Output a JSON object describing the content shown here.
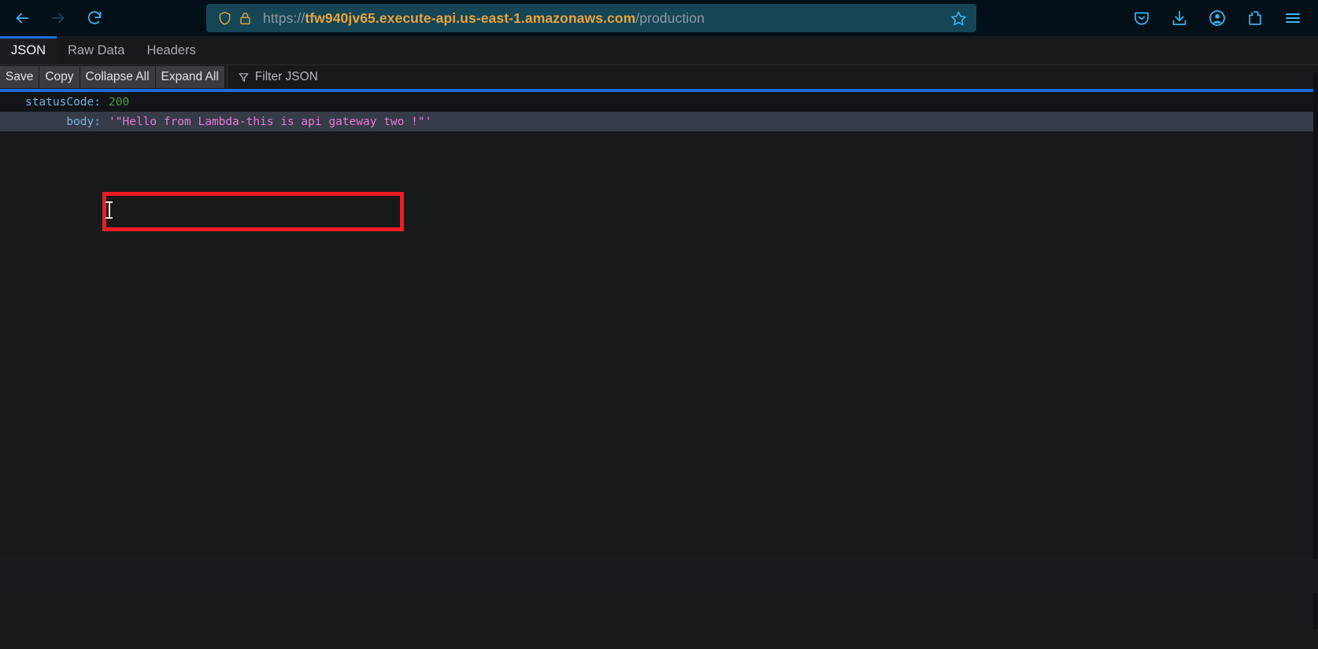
{
  "browser": {
    "nav": {
      "back_label": "Back",
      "forward_label": "Forward",
      "reload_label": "Reload",
      "back_icon": "arrow-left-icon",
      "forward_icon": "arrow-right-icon",
      "reload_icon": "reload-icon"
    },
    "urlbar": {
      "shield_icon": "shield-icon",
      "lock_icon": "padlock-icon",
      "scheme": "https://",
      "host": "tfw940jv65.execute-api.us-east-1.amazonaws.com",
      "path": "/production",
      "full_url": "https://tfw940jv65.execute-api.us-east-1.amazonaws.com/production",
      "bookmark_icon": "star-icon",
      "bookmark_label": "Bookmark this page"
    },
    "toolbar_right": [
      {
        "name": "pocket-icon",
        "label": "Save to Pocket"
      },
      {
        "name": "download-icon",
        "label": "Downloads"
      },
      {
        "name": "account-icon",
        "label": "Account"
      },
      {
        "name": "extensions-icon",
        "label": "Extensions"
      },
      {
        "name": "menu-icon",
        "label": "Open application menu"
      }
    ],
    "colors": {
      "chrome_bg": "#041018",
      "urlbar_bg": "#164656",
      "accent_blue": "#1b6ce0",
      "url_amber": "#e8a33d",
      "icon_blue": "#3bb6f0"
    }
  },
  "json_viewer": {
    "tabs": [
      {
        "label": "JSON",
        "active": true
      },
      {
        "label": "Raw Data",
        "active": false
      },
      {
        "label": "Headers",
        "active": false
      }
    ],
    "actions": [
      {
        "label": "Save"
      },
      {
        "label": "Copy"
      },
      {
        "label": "Collapse All"
      },
      {
        "label": "Expand All"
      }
    ],
    "filter": {
      "icon": "funnel-icon",
      "placeholder": "Filter JSON",
      "value": ""
    },
    "rows": [
      {
        "key": "statusCode:",
        "value": "200",
        "type": "num"
      },
      {
        "key": "body:",
        "value": "'\"Hello from Lambda-this is api gateway two !\"'",
        "type": "str"
      }
    ],
    "colors": {
      "key_blue": "#6fb3e0",
      "number_green": "#4a9b4a",
      "string_pink": "#e978d4",
      "row_odd_bg": "#131417",
      "row_even_bg": "#353b48"
    }
  },
  "annotation": {
    "type": "rectangle-highlight",
    "color": "#ee1c23",
    "target": "body value"
  }
}
